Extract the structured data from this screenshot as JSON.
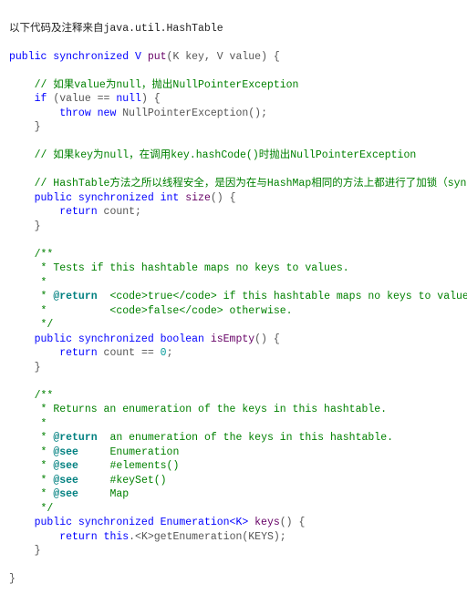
{
  "header": "以下代码及注释来自java.util.HashTable",
  "sig": {
    "prefix": "public synchronized V ",
    "fn": "put",
    "args": "(K key, V value) {"
  },
  "c1": "    // 如果value为null，抛出NullPointerException",
  "if1": {
    "kw": "if",
    "cond": " (value == ",
    "null": "null",
    "close": ") {"
  },
  "throw1": {
    "kw_throw": "throw",
    "kw_new": "new",
    "ex": " NullPointerException();"
  },
  "brace": "}",
  "c2": "    // 如果key为null，在调用key.hashCode()时抛出NullPointerException",
  "c3": "    // HashTable方法之所以线程安全，是因为在与HashMap相同的方法上都进行了加锁（synchronized）操作",
  "size": {
    "prefix": "public synchronized int ",
    "fn": "size",
    "args": "() {"
  },
  "ret_count": {
    "kw": "return",
    "rest": " count;"
  },
  "doc1": {
    "l1": "/**",
    "l2": " * Tests if this hashtable maps no keys to values.",
    "l3": " *",
    "l4a": " * ",
    "tag_return": "@return",
    "l4b": "  <code>true</code> if this hashtable maps no keys to values;",
    "l5": " *          <code>false</code> otherwise.",
    "l6": " */"
  },
  "isEmpty": {
    "prefix": "public synchronized boolean ",
    "fn": "isEmpty",
    "args": "() {"
  },
  "ret_empty": {
    "kw": "return",
    "mid": " count == ",
    "zero": "0",
    "end": ";"
  },
  "doc2": {
    "l1": "/**",
    "l2": " * Returns an enumeration of the keys in this hashtable.",
    "l3": " *",
    "ret_a": " * ",
    "tag_return": "@return",
    "ret_b": "  an enumeration of the keys in this hashtable.",
    "see1a": " * ",
    "tag_see": "@see",
    "see1b": "     Enumeration",
    "see2b": "     #elements()",
    "see3b": "     #keySet()",
    "see4b": "     Map",
    "end": " */"
  },
  "keys": {
    "prefix": "public synchronized Enumeration<K> ",
    "fn": "keys",
    "args": "() {"
  },
  "ret_keys": {
    "kw_return": "return",
    "sp1": " ",
    "kw_this": "this",
    "rest": ".<K>getEnumeration(KEYS);"
  }
}
